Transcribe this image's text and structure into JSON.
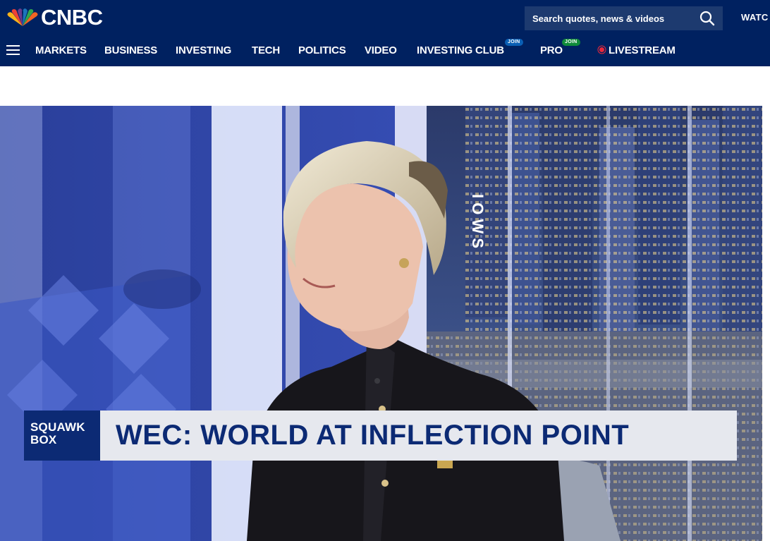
{
  "header": {
    "logo_text": "CNBC",
    "search_placeholder": "Search quotes, news & videos",
    "watch_label": "WATC"
  },
  "nav": {
    "items": [
      {
        "label": "MARKETS"
      },
      {
        "label": "BUSINESS"
      },
      {
        "label": "INVESTING"
      },
      {
        "label": "TECH"
      },
      {
        "label": "POLITICS"
      },
      {
        "label": "VIDEO"
      },
      {
        "label": "INVESTING CLUB",
        "badge": "JOIN"
      },
      {
        "label": "PRO",
        "badge": "JOIN"
      },
      {
        "label": "LIVESTREAM"
      }
    ]
  },
  "video": {
    "show_line1": "SQUAWK",
    "show_line2": "BOX",
    "headline": "WEC: WORLD AT INFLECTION POINT"
  },
  "colors": {
    "brand_navy": "#002160",
    "search_bg": "#1d3a6f",
    "live_red": "#e9283b",
    "join_blue": "#0a5fb4",
    "join_green": "#0f8a3a",
    "lower_third_navy": "#0c2a74",
    "lower_third_bg": "#e6e8ee"
  },
  "icons": {
    "logo": "nbc-peacock-icon",
    "search": "search-icon",
    "menu": "hamburger-menu-icon",
    "live": "live-dot-icon"
  }
}
